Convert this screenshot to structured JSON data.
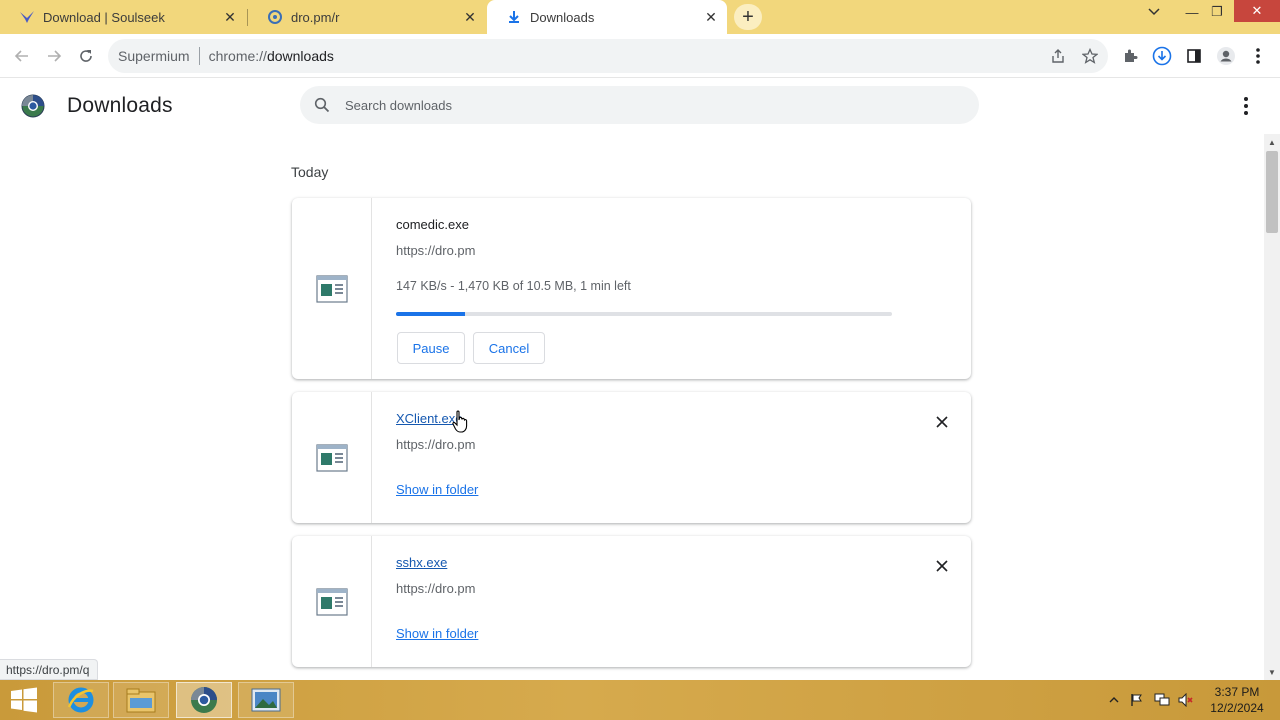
{
  "browser": {
    "tabs": [
      {
        "title": "Download | Soulseek",
        "favicon": "soulseek-bird-icon",
        "active": false
      },
      {
        "title": "dro.pm/r",
        "favicon": "dro-pm-icon",
        "active": false
      },
      {
        "title": "Downloads",
        "favicon": "download-arrow-icon",
        "active": true
      }
    ],
    "new_tab_label": "+",
    "window_controls": {
      "minimize": "—",
      "restore": "❐",
      "close": "✕"
    },
    "omnibox": {
      "brand": "Supermium",
      "scheme": "chrome://",
      "host": "downloads"
    },
    "accent_color": "#f2d77c"
  },
  "page": {
    "title": "Downloads",
    "search_placeholder": "Search downloads",
    "date_group": "Today",
    "downloads": [
      {
        "filename": "comedic.exe",
        "url": "https://dro.pm",
        "status": "147 KB/s - 1,470 KB of 10.5 MB, 1 min left",
        "progress_fraction": 0.14,
        "actions": [
          "Pause",
          "Cancel"
        ],
        "in_progress": true
      },
      {
        "filename": "XClient.exe",
        "url": "https://dro.pm",
        "show_in_folder": "Show in folder",
        "in_progress": false
      },
      {
        "filename": "sshx.exe",
        "url": "https://dro.pm",
        "show_in_folder": "Show in folder",
        "in_progress": false
      }
    ],
    "status_bubble": "https://dro.pm/q"
  },
  "taskbar": {
    "apps": [
      "internet-explorer-icon",
      "file-explorer-icon",
      "supermium-browser-icon",
      "image-viewer-icon"
    ],
    "clock_time": "3:37 PM",
    "clock_date": "12/2/2024"
  }
}
